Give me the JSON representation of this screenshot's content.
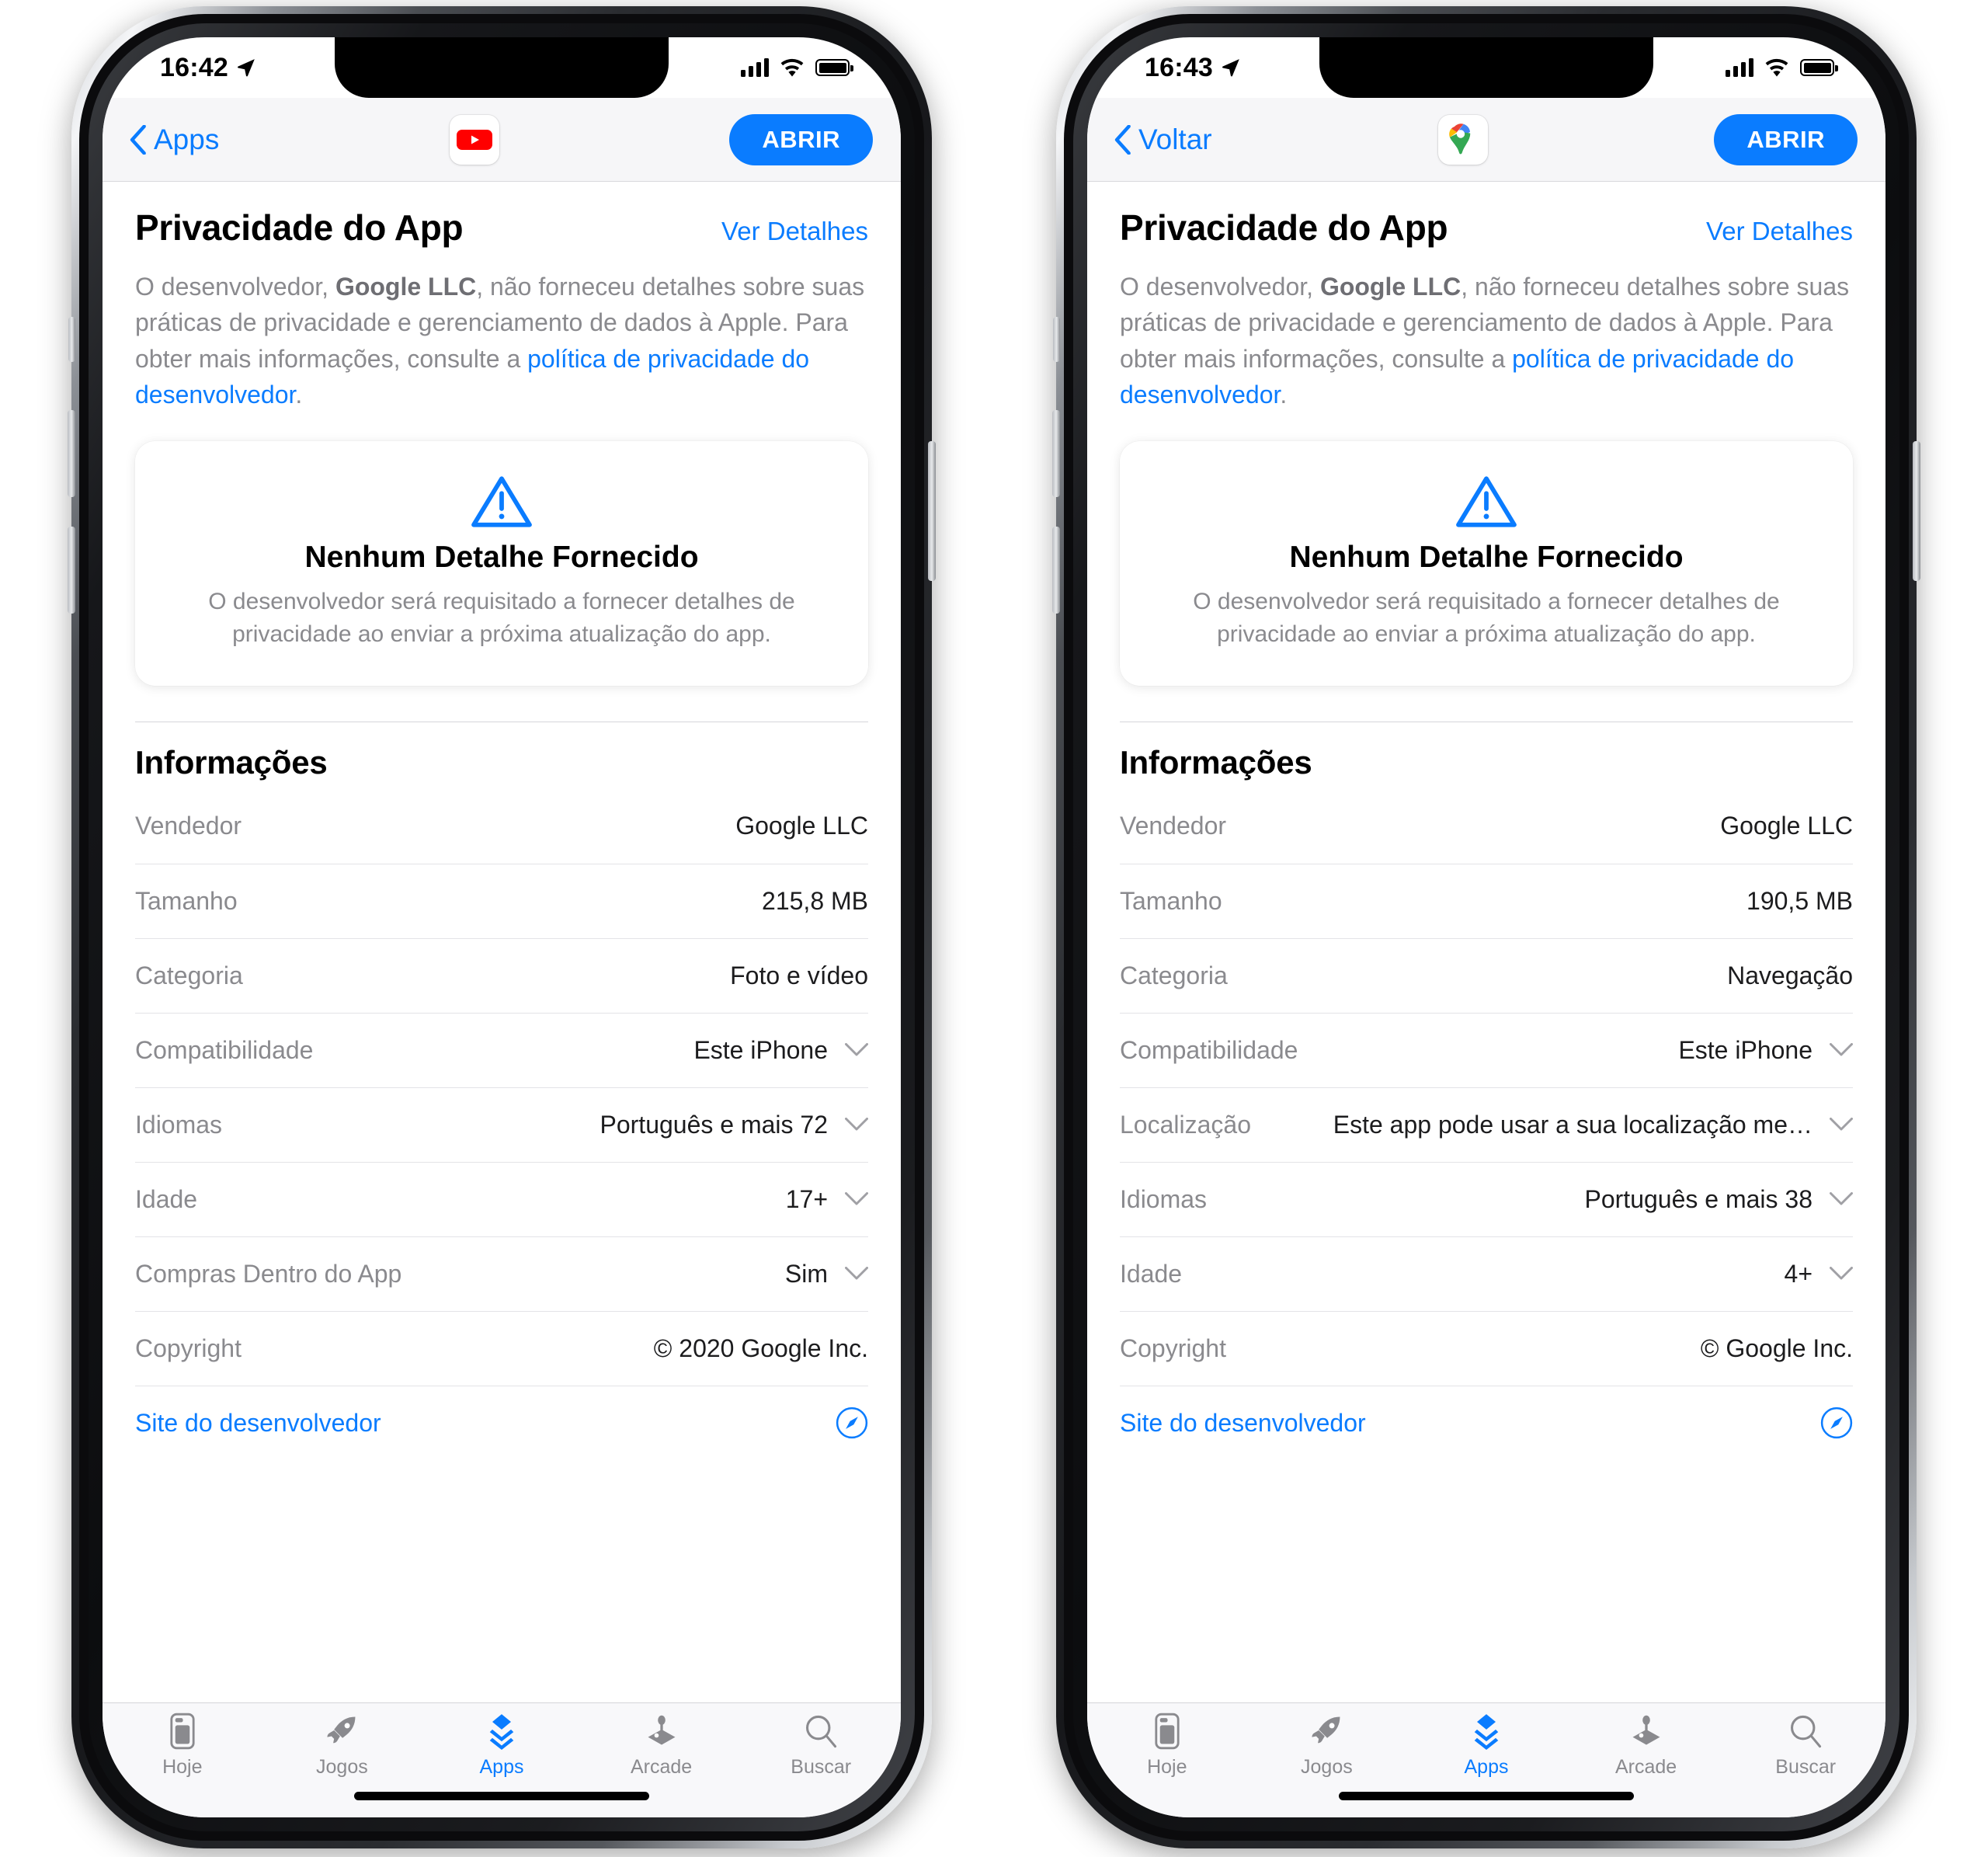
{
  "phones": [
    {
      "id": "youtube",
      "status": {
        "time": "16:42",
        "location_icon": "location-arrow-icon",
        "signal_icon": "cellular-bars-icon",
        "wifi_icon": "wifi-icon",
        "battery_icon": "battery-icon"
      },
      "nav": {
        "back_label": "Apps",
        "back_icon": "chevron-left-icon",
        "app_icon": "youtube-app-icon",
        "open_label": "ABRIR"
      },
      "privacy": {
        "title": "Privacidade do App",
        "details_link": "Ver Detalhes",
        "desc_part1": "O desenvolvedor, ",
        "desc_developer": "Google LLC",
        "desc_part2": ", não forneceu detalhes sobre suas práticas de privacidade e gerenciamento de dados à Apple. Para obter mais informações, consulte a ",
        "desc_link": "política de privacidade do desenvolvedor",
        "desc_part3": "."
      },
      "no_detail": {
        "icon": "warning-triangle-icon",
        "title": "Nenhum Detalhe Fornecido",
        "subtitle": "O desenvolvedor será requisitado a fornecer detalhes de privacidade ao enviar a próxima atualização do app."
      },
      "info": {
        "title": "Informações",
        "rows": [
          {
            "label": "Vendedor",
            "value": "Google LLC",
            "chevron": false
          },
          {
            "label": "Tamanho",
            "value": "215,8 MB",
            "chevron": false
          },
          {
            "label": "Categoria",
            "value": "Foto e vídeo",
            "chevron": false
          },
          {
            "label": "Compatibilidade",
            "value": "Este iPhone",
            "chevron": true
          },
          {
            "label": "Idiomas",
            "value": "Português e mais 72",
            "chevron": true
          },
          {
            "label": "Idade",
            "value": "17+",
            "chevron": true
          },
          {
            "label": "Compras Dentro do App",
            "value": "Sim",
            "chevron": true
          },
          {
            "label": "Copyright",
            "value": "© 2020 Google Inc.",
            "chevron": false
          }
        ],
        "dev_site_label": "Site do desenvolvedor",
        "dev_site_icon": "compass-safari-icon"
      },
      "tabs": [
        {
          "label": "Hoje",
          "icon": "today-card-icon",
          "active": false
        },
        {
          "label": "Jogos",
          "icon": "rocket-icon",
          "active": false
        },
        {
          "label": "Apps",
          "icon": "stacked-layers-icon",
          "active": true
        },
        {
          "label": "Arcade",
          "icon": "joystick-icon",
          "active": false
        },
        {
          "label": "Buscar",
          "icon": "search-icon",
          "active": false
        }
      ]
    },
    {
      "id": "maps",
      "status": {
        "time": "16:43",
        "location_icon": "location-arrow-icon",
        "signal_icon": "cellular-bars-icon",
        "wifi_icon": "wifi-icon",
        "battery_icon": "battery-icon"
      },
      "nav": {
        "back_label": "Voltar",
        "back_icon": "chevron-left-icon",
        "app_icon": "google-maps-app-icon",
        "open_label": "ABRIR"
      },
      "privacy": {
        "title": "Privacidade do App",
        "details_link": "Ver Detalhes",
        "desc_part1": "O desenvolvedor, ",
        "desc_developer": "Google LLC",
        "desc_part2": ", não forneceu detalhes sobre suas práticas de privacidade e gerenciamento de dados à Apple. Para obter mais informações, consulte a ",
        "desc_link": "política de privacidade do desenvolvedor",
        "desc_part3": "."
      },
      "no_detail": {
        "icon": "warning-triangle-icon",
        "title": "Nenhum Detalhe Fornecido",
        "subtitle": "O desenvolvedor será requisitado a fornecer detalhes de privacidade ao enviar a próxima atualização do app."
      },
      "info": {
        "title": "Informações",
        "rows": [
          {
            "label": "Vendedor",
            "value": "Google LLC",
            "chevron": false
          },
          {
            "label": "Tamanho",
            "value": "190,5 MB",
            "chevron": false
          },
          {
            "label": "Categoria",
            "value": "Navegação",
            "chevron": false
          },
          {
            "label": "Compatibilidade",
            "value": "Este iPhone",
            "chevron": true
          },
          {
            "label": "Localização",
            "value": "Este app pode usar a sua localização me…",
            "chevron": true
          },
          {
            "label": "Idiomas",
            "value": "Português e mais 38",
            "chevron": true
          },
          {
            "label": "Idade",
            "value": "4+",
            "chevron": true
          },
          {
            "label": "Copyright",
            "value": "© Google Inc.",
            "chevron": false
          }
        ],
        "dev_site_label": "Site do desenvolvedor",
        "dev_site_icon": "compass-safari-icon"
      },
      "tabs": [
        {
          "label": "Hoje",
          "icon": "today-card-icon",
          "active": false
        },
        {
          "label": "Jogos",
          "icon": "rocket-icon",
          "active": false
        },
        {
          "label": "Apps",
          "icon": "stacked-layers-icon",
          "active": true
        },
        {
          "label": "Arcade",
          "icon": "joystick-icon",
          "active": false
        },
        {
          "label": "Buscar",
          "icon": "search-icon",
          "active": false
        }
      ]
    }
  ],
  "colors": {
    "accent_blue": "#0a7cff",
    "label_gray": "#8a8a8e",
    "youtube_red": "#ff0000",
    "separator": "#e3e3e7"
  }
}
